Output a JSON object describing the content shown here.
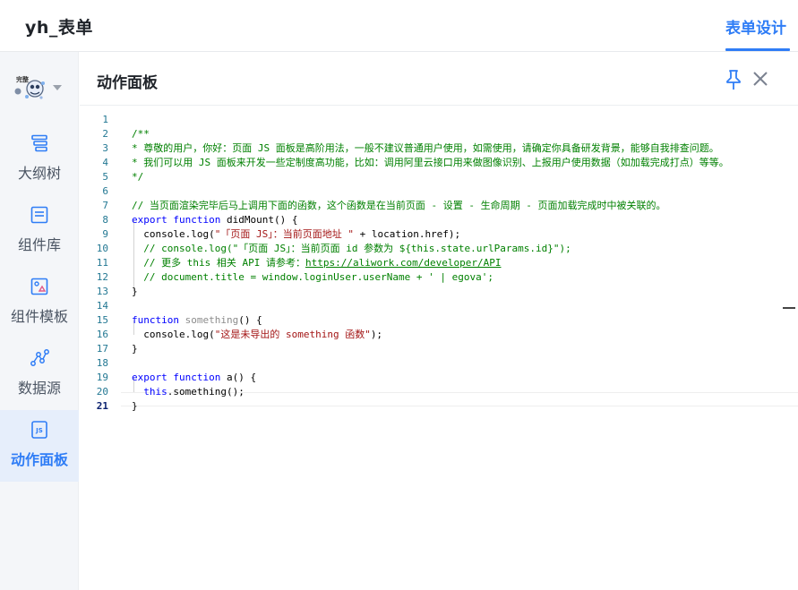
{
  "header": {
    "app_title": "yh_表单",
    "active_tab_label": "表单设计",
    "accent_color": "#2f7df6"
  },
  "sidebar": {
    "avatar_label": "完整",
    "items": [
      {
        "label": "大纲树",
        "icon": "outline-tree-icon"
      },
      {
        "label": "组件库",
        "icon": "component-library-icon"
      },
      {
        "label": "组件模板",
        "icon": "component-template-icon"
      },
      {
        "label": "数据源",
        "icon": "data-source-icon"
      },
      {
        "label": "动作面板",
        "icon": "js-action-icon",
        "active": true
      }
    ]
  },
  "panel": {
    "title": "动作面板",
    "pin_icon": "pin-icon",
    "close_icon": "close-icon"
  },
  "editor": {
    "current_line": 21,
    "lines": [
      {
        "n": "1",
        "tokens": []
      },
      {
        "n": "2",
        "tokens": [
          {
            "t": "/**",
            "c": "c-comment"
          }
        ]
      },
      {
        "n": "3",
        "tokens": [
          {
            "t": "* 尊敬的用户，你好：页面 JS 面板是高阶用法，一般不建议普通用户使用，如需使用，请确定你具备研发背景，能够自我排查问题。",
            "c": "c-comment"
          }
        ]
      },
      {
        "n": "4",
        "tokens": [
          {
            "t": "* 我们可以用 JS 面板来开发一些定制度高功能，比如：调用阿里云接口用来做图像识别、上报用户使用数据（如加载完成打点）等等。",
            "c": "c-comment"
          }
        ]
      },
      {
        "n": "5",
        "tokens": [
          {
            "t": "*/",
            "c": "c-comment"
          }
        ]
      },
      {
        "n": "6",
        "tokens": []
      },
      {
        "n": "7",
        "tokens": [
          {
            "t": "// 当页面渲染完毕后马上调用下面的函数，这个函数是在当前页面 - 设置 - 生命周期 - 页面加载完成时中被关联的。",
            "c": "c-comment"
          }
        ]
      },
      {
        "n": "8",
        "tokens": [
          {
            "t": "export",
            "c": "c-kw"
          },
          {
            "t": " ",
            "c": "c-plain"
          },
          {
            "t": "function",
            "c": "c-kw"
          },
          {
            "t": " didMount() {",
            "c": "c-plain"
          }
        ]
      },
      {
        "n": "9",
        "tokens": [
          {
            "t": "  console.log(",
            "c": "c-plain"
          },
          {
            "t": "\"「页面 JS」：当前页面地址 \"",
            "c": "c-str"
          },
          {
            "t": " + location.href);",
            "c": "c-plain"
          }
        ]
      },
      {
        "n": "10",
        "tokens": [
          {
            "t": "  ",
            "c": "c-plain"
          },
          {
            "t": "// console.log(\"「页面 JS」：当前页面 id 参数为 ${this.state.urlParams.id}\");",
            "c": "c-comment"
          }
        ]
      },
      {
        "n": "11",
        "tokens": [
          {
            "t": "  ",
            "c": "c-plain"
          },
          {
            "t": "// 更多 this 相关 API 请参考：",
            "c": "c-comment"
          },
          {
            "t": "https://aliwork.com/developer/API",
            "c": "c-link"
          }
        ]
      },
      {
        "n": "12",
        "tokens": [
          {
            "t": "  ",
            "c": "c-plain"
          },
          {
            "t": "// document.title = window.loginUser.userName + ' | egova';",
            "c": "c-comment"
          }
        ]
      },
      {
        "n": "13",
        "tokens": [
          {
            "t": "}",
            "c": "c-plain"
          }
        ]
      },
      {
        "n": "14",
        "tokens": []
      },
      {
        "n": "15",
        "tokens": [
          {
            "t": "function",
            "c": "c-kw"
          },
          {
            "t": " ",
            "c": "c-plain"
          },
          {
            "t": "something",
            "c": "c-dim"
          },
          {
            "t": "() {",
            "c": "c-plain"
          }
        ]
      },
      {
        "n": "16",
        "tokens": [
          {
            "t": "  console.log(",
            "c": "c-plain"
          },
          {
            "t": "\"这是未导出的 something 函数\"",
            "c": "c-str"
          },
          {
            "t": ");",
            "c": "c-plain"
          }
        ]
      },
      {
        "n": "17",
        "tokens": [
          {
            "t": "}",
            "c": "c-plain"
          }
        ]
      },
      {
        "n": "18",
        "tokens": []
      },
      {
        "n": "19",
        "tokens": [
          {
            "t": "export",
            "c": "c-kw"
          },
          {
            "t": " ",
            "c": "c-plain"
          },
          {
            "t": "function",
            "c": "c-kw"
          },
          {
            "t": " a() {",
            "c": "c-plain"
          }
        ]
      },
      {
        "n": "20",
        "tokens": [
          {
            "t": "  ",
            "c": "c-plain"
          },
          {
            "t": "this",
            "c": "c-kw"
          },
          {
            "t": ".something();",
            "c": "c-plain"
          }
        ]
      },
      {
        "n": "21",
        "tokens": [
          {
            "t": "}",
            "c": "c-plain"
          }
        ]
      }
    ]
  }
}
